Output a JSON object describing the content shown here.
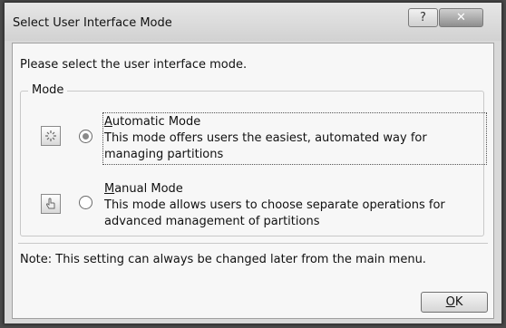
{
  "window": {
    "title": "Select User Interface Mode",
    "help_glyph": "?",
    "close_glyph": "✕"
  },
  "dialog": {
    "prompt": "Please select the user interface mode.",
    "group_label": "Mode",
    "options": [
      {
        "title_access_key": "A",
        "title_rest": "utomatic Mode",
        "description": "This mode offers users the easiest, automated way for managing partitions",
        "selected": true,
        "icon": "sparkle-icon"
      },
      {
        "title_access_key": "M",
        "title_rest": "anual Mode",
        "description": "This mode allows users to choose separate operations for advanced management of partitions",
        "selected": false,
        "icon": "hand-pointer-icon"
      }
    ],
    "note": "Note: This setting can always be changed later from the main menu.",
    "ok_access_key": "O",
    "ok_rest": "K"
  }
}
